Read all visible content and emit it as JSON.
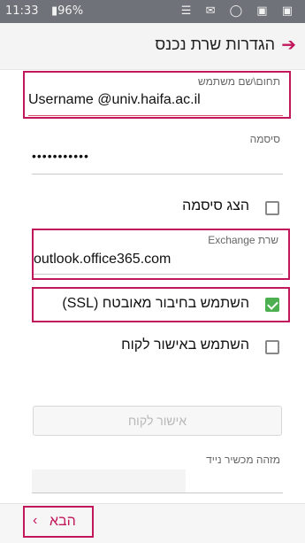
{
  "status_bar": {
    "time": "11:33",
    "battery": "96%",
    "left_icons": "▮ ▌▙",
    "right_icons": "☰ ✉ ◯ ▣ ▣"
  },
  "header": {
    "title": "הגדרות שרת נכנס",
    "back_icon": "arrow-right-icon"
  },
  "fields": {
    "domain_user_label": "תחום\\שם משתמש",
    "domain_user_value": "Username @univ.haifa.ac.il",
    "password_label": "סיסמה",
    "password_value": "•••••••••••",
    "show_password_label": "הצג סיסמה",
    "exchange_server_label": "שרת Exchange",
    "exchange_server_value": "outlook.office365.com",
    "ssl_label": "השתמש בחיבור מאובטח (SSL)",
    "client_cert_label": "השתמש באישור לקוח",
    "client_cert_button": "אישור לקוח",
    "mobile_id_label": "מזהה מכשיר נייד"
  },
  "states": {
    "show_password_checked": false,
    "ssl_checked": true,
    "client_cert_checked": false
  },
  "footer": {
    "next_label": "הבא"
  },
  "colors": {
    "accent": "#c2185b",
    "check_green": "#4caf50",
    "status_bar": "#6f7278"
  }
}
